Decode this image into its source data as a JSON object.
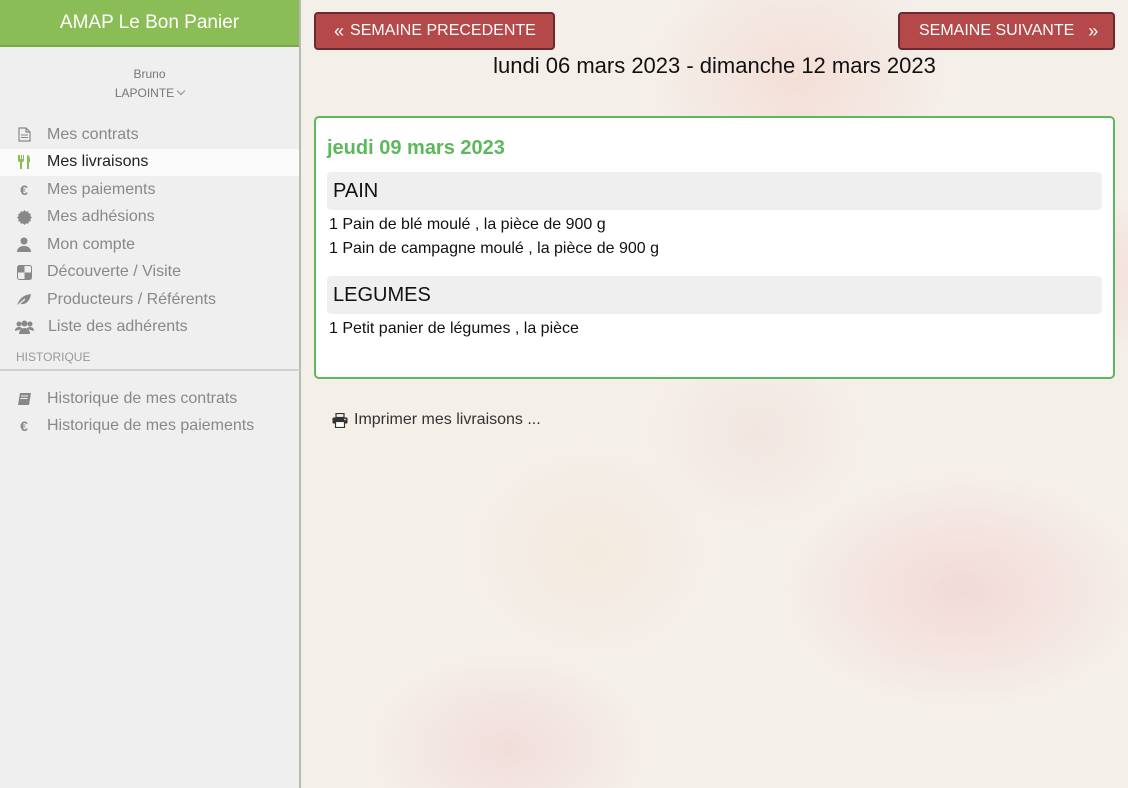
{
  "app": {
    "brand": "AMAP Le Bon Panier"
  },
  "user": {
    "first_name": "Bruno",
    "last_name": "LAPOINTE"
  },
  "sidebar": {
    "items": [
      {
        "label": "Mes contrats",
        "icon": "file-icon",
        "active": false
      },
      {
        "label": "Mes livraisons",
        "icon": "cutlery-icon",
        "active": true
      },
      {
        "label": "Mes paiements",
        "icon": "euro-icon",
        "active": false
      },
      {
        "label": "Mes adhésions",
        "icon": "certificate-icon",
        "active": false
      },
      {
        "label": "Mon compte",
        "icon": "user-icon",
        "active": false
      },
      {
        "label": "Découverte / Visite",
        "icon": "checker-icon",
        "active": false
      },
      {
        "label": "Producteurs / Référents",
        "icon": "leaf-icon",
        "active": false
      },
      {
        "label": "Liste des adhérents",
        "icon": "users-icon",
        "active": false
      }
    ],
    "history_title": "HISTORIQUE",
    "history_items": [
      {
        "label": "Historique de mes contrats",
        "icon": "book-icon"
      },
      {
        "label": "Historique de mes paiements",
        "icon": "euro-icon"
      }
    ]
  },
  "nav": {
    "prev_label": "SEMAINE PRECEDENTE",
    "next_label": "SEMAINE SUIVANTE",
    "week_range": "lundi 06 mars 2023 - dimanche 12 mars 2023"
  },
  "delivery": {
    "day": "jeudi 09 mars 2023",
    "categories": [
      {
        "name": "PAIN",
        "items": [
          "1 Pain de blé moulé , la pièce de 900 g",
          "1 Pain de campagne moulé , la pièce de 900 g"
        ]
      },
      {
        "name": "LEGUMES",
        "items": [
          "1 Petit panier de légumes , la pièce"
        ]
      }
    ]
  },
  "print_label": "Imprimer mes livraisons ...",
  "colors": {
    "brand_green": "#8bbd57",
    "accent_green": "#5cb85c",
    "button_red": "#b54848"
  }
}
